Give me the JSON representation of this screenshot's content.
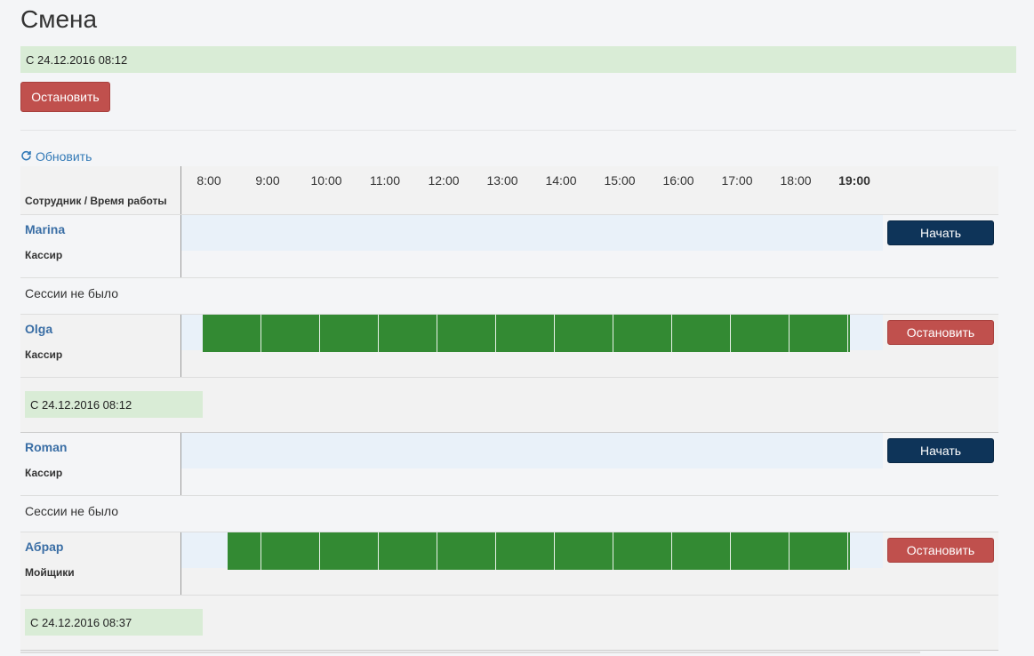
{
  "page": {
    "title": "Смена"
  },
  "shift": {
    "since": "С 24.12.2016 08:12",
    "stop_label": "Остановить"
  },
  "refresh": {
    "label": "Обновить"
  },
  "timeline": {
    "header_label": "Сотрудник / Время работы",
    "hours": [
      "8:00",
      "9:00",
      "10:00",
      "11:00",
      "12:00",
      "13:00",
      "14:00",
      "15:00",
      "16:00",
      "17:00",
      "18:00",
      "19:00"
    ],
    "current_hour": "19:00"
  },
  "employees": [
    {
      "name": "Marina",
      "role": "Кассир",
      "action_label": "Начать",
      "status_text": "Сессии не было"
    },
    {
      "name": "Olga",
      "role": "Кассир",
      "action_label": "Остановить",
      "session_since": "С 24.12.2016 08:12"
    },
    {
      "name": "Roman",
      "role": "Кассир",
      "action_label": "Начать",
      "status_text": "Сессии не было"
    },
    {
      "name": "Абрар",
      "role": "Мойщики",
      "action_label": "Остановить",
      "session_since": "С 24.12.2016 08:37"
    }
  ],
  "colors": {
    "stop": "#c0504d",
    "start": "#0e3459",
    "active_bar": "#338a33",
    "session_bg": "#d9ecd6",
    "timeline_bg": "#e9f1f9"
  }
}
